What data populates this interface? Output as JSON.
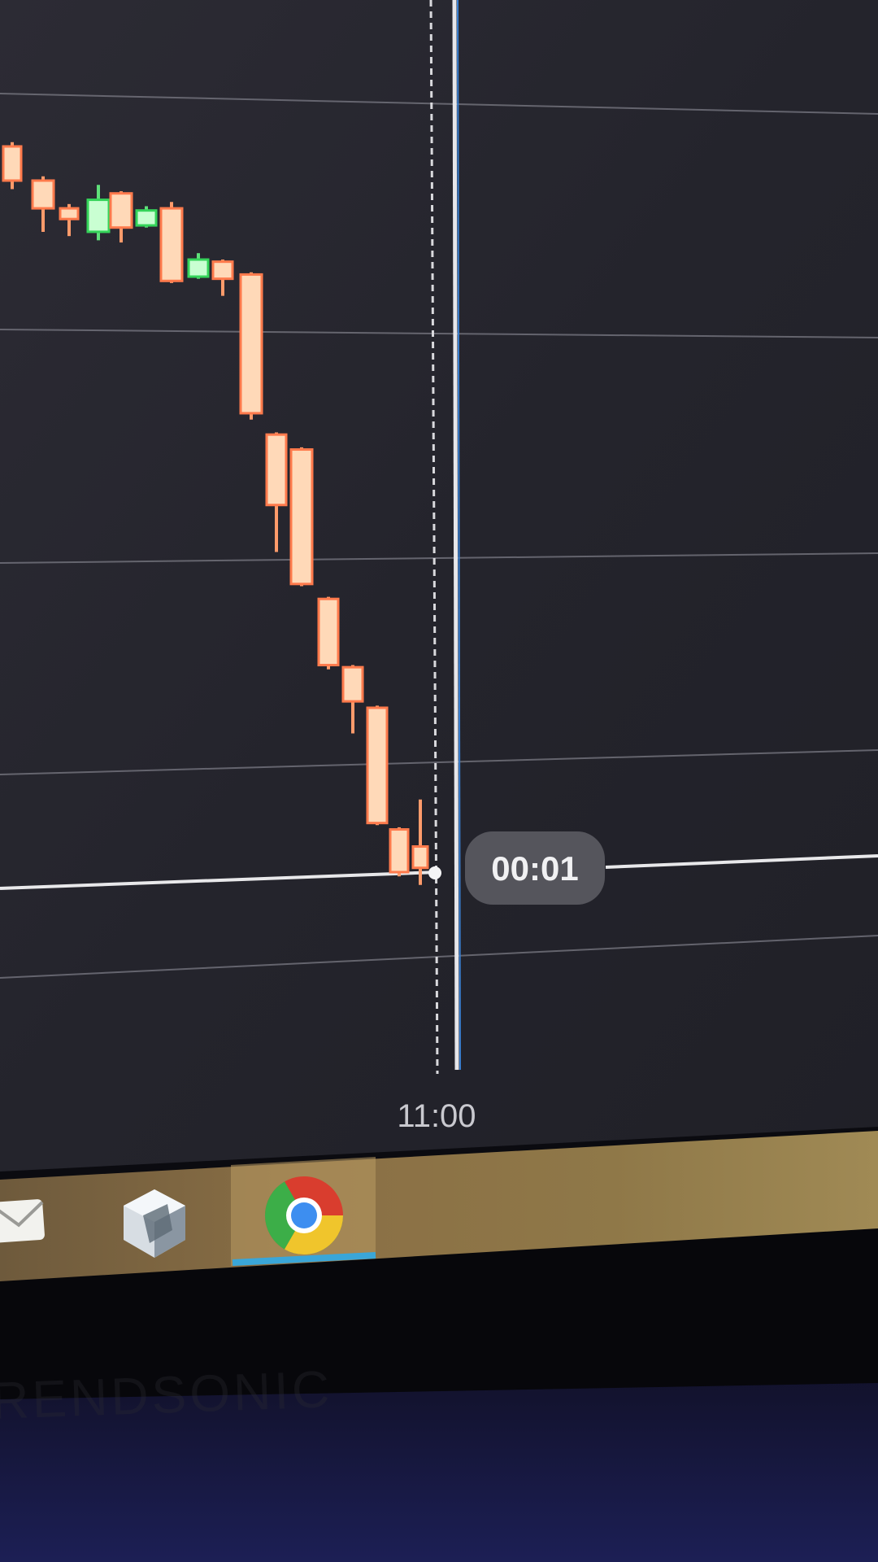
{
  "chart_data": {
    "type": "candlestick",
    "timer": "00:01",
    "x_tick_labels": [
      "11:00"
    ],
    "candles": [
      {
        "dir": "down",
        "open": 100,
        "close": 84,
        "high": 102,
        "low": 80
      },
      {
        "dir": "down",
        "open": 84,
        "close": 71,
        "high": 86,
        "low": 60
      },
      {
        "dir": "down",
        "open": 71,
        "close": 66,
        "high": 73,
        "low": 58
      },
      {
        "dir": "up",
        "open": 60,
        "close": 75,
        "high": 82,
        "low": 56
      },
      {
        "dir": "down",
        "open": 78,
        "close": 62,
        "high": 79,
        "low": 55
      },
      {
        "dir": "up",
        "open": 63,
        "close": 70,
        "high": 72,
        "low": 62
      },
      {
        "dir": "down",
        "open": 71,
        "close": 37,
        "high": 74,
        "low": 36
      },
      {
        "dir": "up",
        "open": 39,
        "close": 47,
        "high": 50,
        "low": 38
      },
      {
        "dir": "down",
        "open": 46,
        "close": 38,
        "high": 47,
        "low": 30
      },
      {
        "dir": "down",
        "open": 40,
        "close": -25,
        "high": 41,
        "low": -28
      },
      {
        "dir": "down",
        "open": -35,
        "close": -68,
        "high": -34,
        "low": -90
      },
      {
        "dir": "down",
        "open": -42,
        "close": -105,
        "high": -41,
        "low": -106
      },
      {
        "dir": "down",
        "open": -112,
        "close": -143,
        "high": -111,
        "low": -145
      },
      {
        "dir": "down",
        "open": -144,
        "close": -160,
        "high": -143,
        "low": -175
      },
      {
        "dir": "down",
        "open": -163,
        "close": -217,
        "high": -162,
        "low": -218
      },
      {
        "dir": "down",
        "open": -220,
        "close": -240,
        "high": -219,
        "low": -242
      },
      {
        "dir": "down",
        "open": -228,
        "close": -238,
        "high": -206,
        "low": -246
      }
    ],
    "current_price": -241
  },
  "taskbar": {
    "icons": [
      {
        "name": "mail-icon"
      },
      {
        "name": "cube-app-icon"
      },
      {
        "name": "chrome-icon",
        "active": true
      }
    ]
  },
  "colors": {
    "chart_bg": "#2a2a32",
    "bear": "#ff7a4c",
    "bull": "#35d45a",
    "taskbar": "#8a6a3c"
  }
}
